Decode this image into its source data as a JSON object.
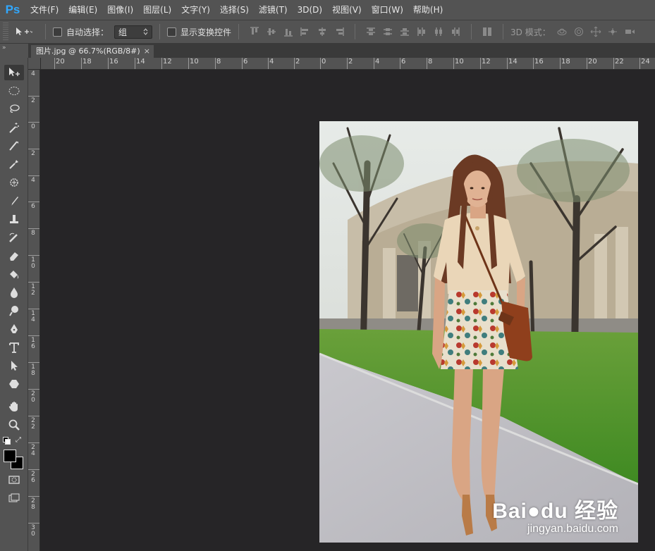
{
  "app": {
    "logo": "Ps"
  },
  "menu": [
    "文件(F)",
    "编辑(E)",
    "图像(I)",
    "图层(L)",
    "文字(Y)",
    "选择(S)",
    "滤镜(T)",
    "3D(D)",
    "视图(V)",
    "窗口(W)",
    "帮助(H)"
  ],
  "options": {
    "auto_select_label": "自动选择：",
    "auto_select_value": "组",
    "show_transform_label": "显示变换控件",
    "mode_3d_label": "3D 模式："
  },
  "tab": {
    "title": "图片.jpg @ 66.7%(RGB/8#)",
    "close": "×"
  },
  "panel_collapse": "»",
  "ruler_h": [
    "20",
    "18",
    "16",
    "14",
    "12",
    "10",
    "8",
    "6",
    "4",
    "2",
    "0",
    "2",
    "4",
    "6",
    "8",
    "10",
    "12",
    "14",
    "16",
    "18",
    "20",
    "22",
    "24"
  ],
  "ruler_v": [
    "4",
    "2",
    "0",
    "2",
    "4",
    "6",
    "8",
    "10",
    "12",
    "14",
    "16",
    "18",
    "20",
    "22",
    "24",
    "26",
    "28",
    "30"
  ],
  "watermark": {
    "brand": "Bai●du 经验",
    "url": "jingyan.baidu.com"
  },
  "colors": {
    "foreground": "#000000",
    "background": "#000000",
    "accent": "#31a8ff"
  },
  "tools": [
    "move-icon",
    "marquee-icon",
    "lasso-icon",
    "magic-wand-icon",
    "crop-icon",
    "eyedropper-icon",
    "healing-icon",
    "brush-icon",
    "stamp-icon",
    "history-brush-icon",
    "eraser-icon",
    "paint-bucket-icon",
    "blur-icon",
    "dodge-icon",
    "pen-icon",
    "type-icon",
    "path-select-icon",
    "shape-icon",
    "hand-icon",
    "zoom-icon"
  ]
}
